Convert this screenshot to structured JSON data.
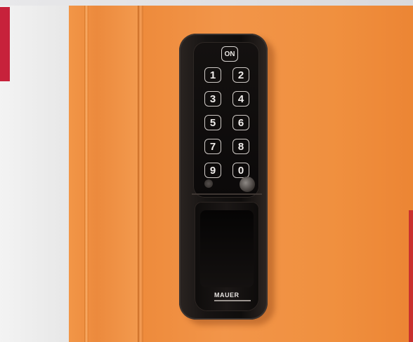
{
  "photo": {
    "subject": "keypad-lock",
    "colors": {
      "locker": "#f08a3c",
      "lock_body": "#151211",
      "key_outline": "#cfcac6",
      "accent_red": "#c7223b"
    }
  },
  "keypad": {
    "on_label": "ON",
    "keys": [
      "1",
      "2",
      "3",
      "4",
      "5",
      "6",
      "7",
      "8",
      "9",
      "0"
    ]
  },
  "brand": {
    "label": "MAUER"
  }
}
